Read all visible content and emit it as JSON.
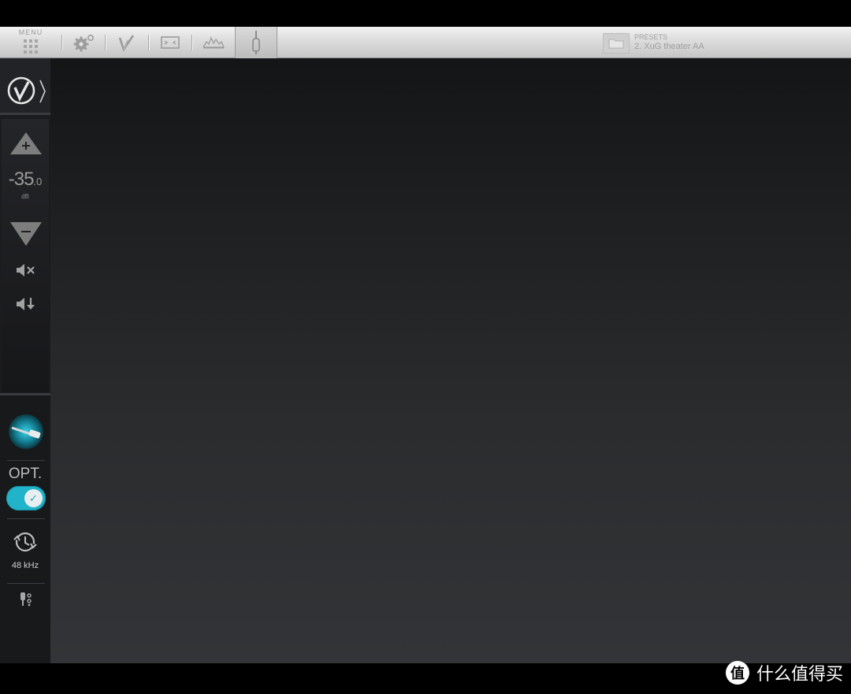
{
  "toolbar": {
    "menu_label": "MENU",
    "tabs": [
      {
        "icon": "gear-icon",
        "active": false
      },
      {
        "icon": "check-logo-icon",
        "active": false
      },
      {
        "icon": "screen-icon",
        "active": false
      },
      {
        "icon": "waveform-icon",
        "active": false
      },
      {
        "icon": "connector-icon",
        "active": true
      }
    ],
    "presets": {
      "title": "PRESETS",
      "name": "2. XuG theater AA",
      "icon": "folder-icon"
    }
  },
  "sidebar": {
    "logo_icon": "check-circle-icon",
    "expand_icon": "chevron-right-icon",
    "volume": {
      "value": "-35",
      "fraction": ".0",
      "unit": "dB"
    },
    "volume_up_icon": "triangle-up-plus-icon",
    "volume_down_icon": "triangle-down-minus-icon",
    "mute_icon": "speaker-mute-icon",
    "dim_icon": "speaker-down-icon",
    "input_icon": "cable-connector-icon",
    "input_label": "OPT.",
    "input_toggle": {
      "on": true,
      "color": "#21b3c9"
    },
    "sample_rate_icon": "clock-sync-icon",
    "sample_rate": "48 kHz",
    "output_icon": "output-jack-icon"
  },
  "watermark": {
    "text": "什么值得买",
    "logo": "值"
  }
}
